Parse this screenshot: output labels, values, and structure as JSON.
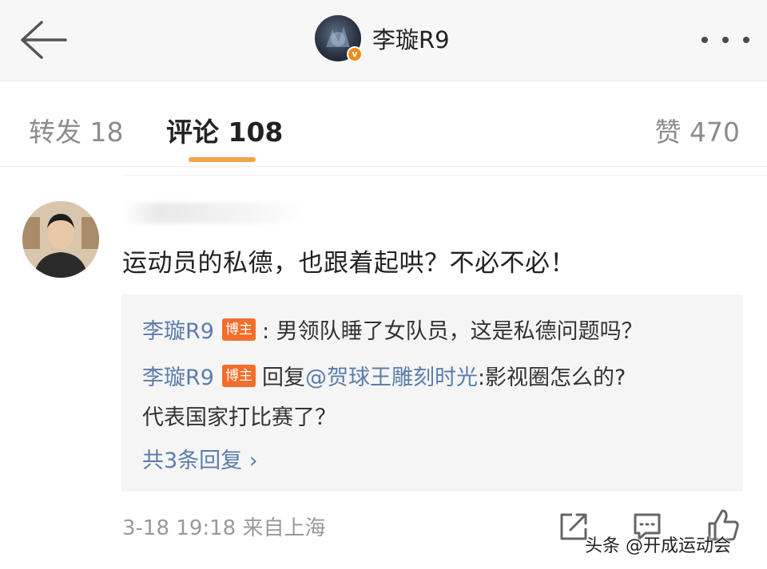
{
  "header": {
    "back_icon": "arrow-left-icon",
    "title": "李璇R9",
    "verified_badge": "v",
    "more_icon": "more-horizontal-icon"
  },
  "tabs": {
    "repost": "转发 18",
    "comments": "评论 108",
    "likes": "赞 470",
    "active_color": "#f0a34a"
  },
  "comment": {
    "text": "运动员的私德，也跟着起哄？不必不必！",
    "replies": [
      {
        "author": "李璇R9",
        "badge": "博主",
        "text": ": 男领队睡了女队员，这是私德问题吗？"
      },
      {
        "author": "李璇R9",
        "badge": "博主",
        "prefix": "回复",
        "mention": "@贺球王雕刻时光",
        "text": ":影视圈怎么的?",
        "continuation": "代表国家打比赛了？"
      }
    ],
    "more_replies": "共3条回复 ›",
    "meta": "3-18 19:18  来自上海"
  },
  "footer": {
    "share_icon": "share-icon",
    "comment_icon": "comment-icon",
    "like_icon": "thumbs-up-icon",
    "watermark": "头条 @开成运动会"
  }
}
